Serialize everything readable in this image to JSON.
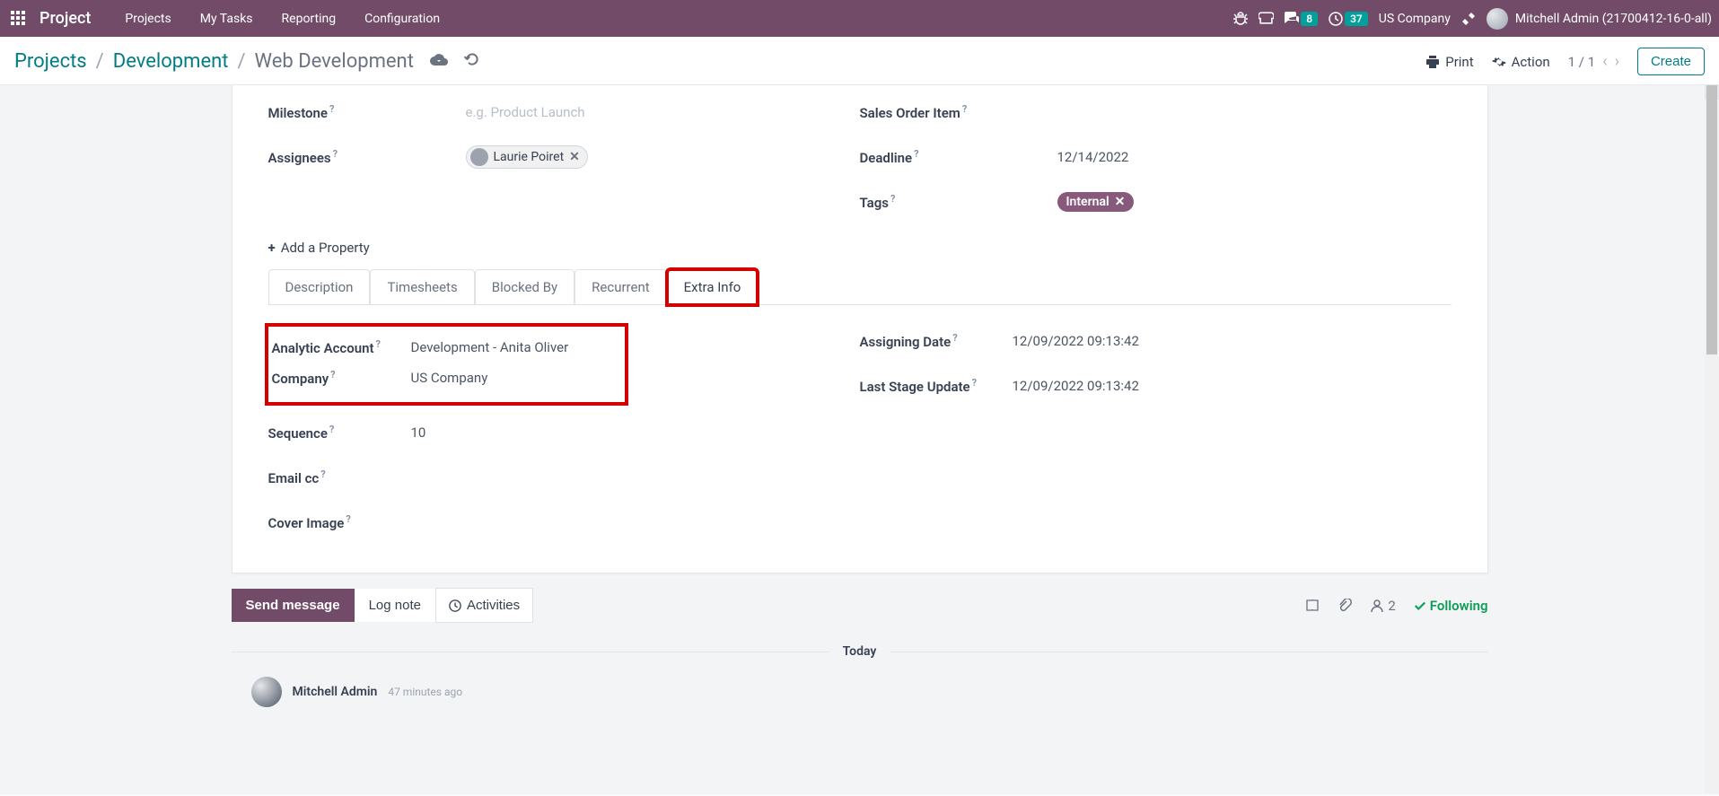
{
  "nav": {
    "brand": "Project",
    "items": [
      "Projects",
      "My Tasks",
      "Reporting",
      "Configuration"
    ],
    "messages_count": "8",
    "activities_count": "37",
    "company": "US Company",
    "user": "Mitchell Admin (21700412-16-0-all)"
  },
  "breadcrumb": {
    "items": [
      "Projects",
      "Development",
      "Web Development"
    ]
  },
  "controlPanel": {
    "print": "Print",
    "action": "Action",
    "pager": "1 / 1",
    "create": "Create"
  },
  "fields": {
    "milestone_label": "Milestone",
    "milestone_placeholder": "e.g. Product Launch",
    "assignees_label": "Assignees",
    "assignee_name": "Laurie Poiret",
    "sales_order_label": "Sales Order Item",
    "deadline_label": "Deadline",
    "deadline_value": "12/14/2022",
    "tags_label": "Tags",
    "tag_value": "Internal",
    "add_property": "Add a Property"
  },
  "tabs": {
    "items": [
      "Description",
      "Timesheets",
      "Blocked By",
      "Recurrent",
      "Extra Info"
    ]
  },
  "extraInfo": {
    "analytic_label": "Analytic Account",
    "analytic_value": "Development - Anita Oliver",
    "company_label": "Company",
    "company_value": "US Company",
    "sequence_label": "Sequence",
    "sequence_value": "10",
    "emailcc_label": "Email cc",
    "cover_label": "Cover Image",
    "assigning_date_label": "Assigning Date",
    "assigning_date_value": "12/09/2022 09:13:42",
    "last_stage_label": "Last Stage Update",
    "last_stage_value": "12/09/2022 09:13:42"
  },
  "chatter": {
    "send": "Send message",
    "log": "Log note",
    "activities": "Activities",
    "followers": "2",
    "following": "Following",
    "separator": "Today",
    "msg_author": "Mitchell Admin",
    "msg_time": "47 minutes ago"
  }
}
